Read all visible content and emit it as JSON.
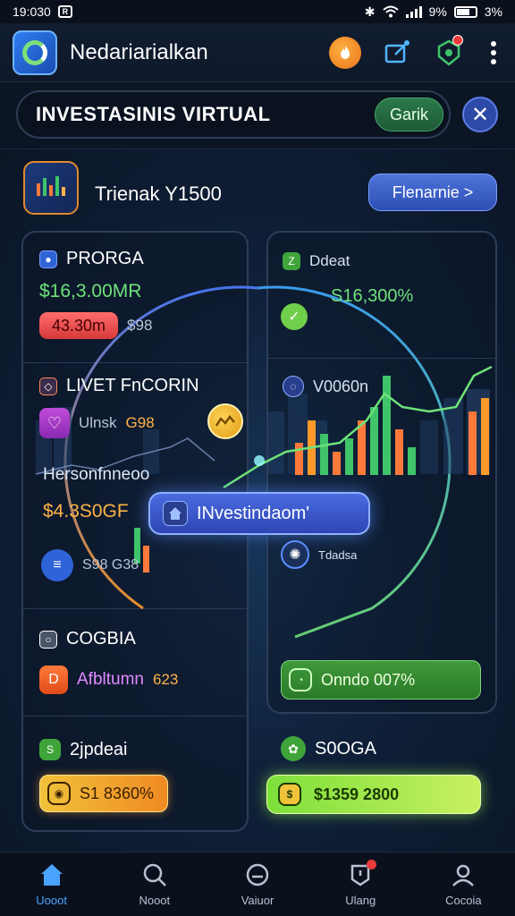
{
  "status_bar": {
    "time": "19:030",
    "notif_icon": "R",
    "battery_text": "9%",
    "battery_text2": "3%"
  },
  "app_bar": {
    "title": "Nedariarialkan",
    "icons": [
      "flame-icon",
      "edit-icon",
      "shield-icon",
      "more-icon"
    ]
  },
  "search": {
    "value": "INVESTASINIS VIRTUAL",
    "button_label": "Garik",
    "close_icon": "close-icon"
  },
  "header": {
    "title": "Trienak Y1500",
    "button_label": "Flenarnie >"
  },
  "left_panel": {
    "section1": {
      "label": "PRORGA",
      "value": "$16,3.00MR",
      "pill": "43.30m",
      "pill_note": "$98"
    },
    "section2": {
      "label": "LIVET FnCORIN",
      "sub_label": "Ulnsk",
      "sub_value": "G98",
      "caption": "Hersonfnneoo",
      "amount": "$4.3S0GF",
      "foot": "S98 G38"
    },
    "section3": {
      "label": "COGBIA",
      "sub_label": "Afbltumn",
      "sub_value": "623"
    },
    "section4": {
      "label": "2jpdeai",
      "button_label": "S1 8360%"
    }
  },
  "right_panel": {
    "section1": {
      "label": "Ddeat",
      "value": "S16,300%"
    },
    "section2": {
      "label": "V0060n"
    },
    "section3": {
      "label": "Tdadsa",
      "button_label": "Onndo 007%"
    }
  },
  "right_bottom": {
    "label": "S0OGA",
    "button_label": "$1359 2800"
  },
  "center_button": {
    "label": "INvestindaom'"
  },
  "bottom_nav": [
    {
      "label": "Uooot",
      "icon": "home-icon"
    },
    {
      "label": "Nooot",
      "icon": "search-icon"
    },
    {
      "label": "Vaiuor",
      "icon": "wallet-icon"
    },
    {
      "label": "Ulang",
      "icon": "alert-icon"
    },
    {
      "label": "Cocoia",
      "icon": "profile-icon"
    }
  ],
  "colors": {
    "accent": "#4aa3ff",
    "positive": "#6fe27a",
    "warning": "#ffb347",
    "danger": "#e83a3a"
  }
}
